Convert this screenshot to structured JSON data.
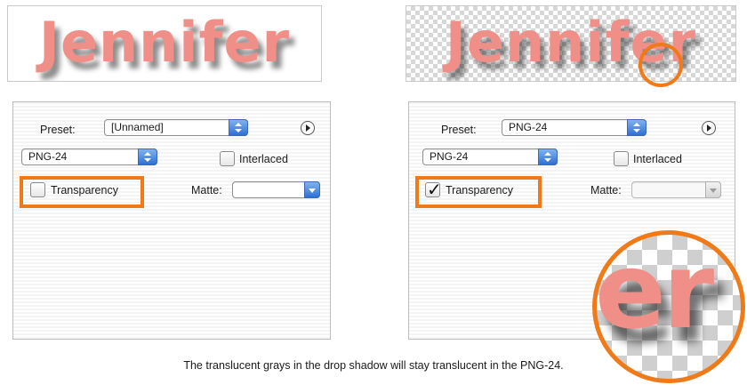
{
  "banner": {
    "text": "Jennifer"
  },
  "left_panel": {
    "preset_label": "Preset:",
    "preset_value": "[Unnamed]",
    "format_value": "PNG-24",
    "interlaced_label": "Interlaced",
    "interlaced_checked": false,
    "transparency_label": "Transparency",
    "transparency_checked": false,
    "matte_label": "Matte:",
    "matte_value": ""
  },
  "right_panel": {
    "preset_label": "Preset:",
    "preset_value": "PNG-24",
    "format_value": "PNG-24",
    "interlaced_label": "Interlaced",
    "interlaced_checked": false,
    "transparency_label": "Transparency",
    "transparency_checked": true,
    "checkmark_glyph": "✓",
    "matte_label": "Matte:",
    "matte_value": ""
  },
  "zoom": {
    "letters": "er"
  },
  "caption": "The translucent grays in the drop shadow will stay translucent in the PNG-24.",
  "colors": {
    "highlight": "#f07a18",
    "text_pink": "#ef8f88",
    "select_blue": "#3c7be0"
  }
}
